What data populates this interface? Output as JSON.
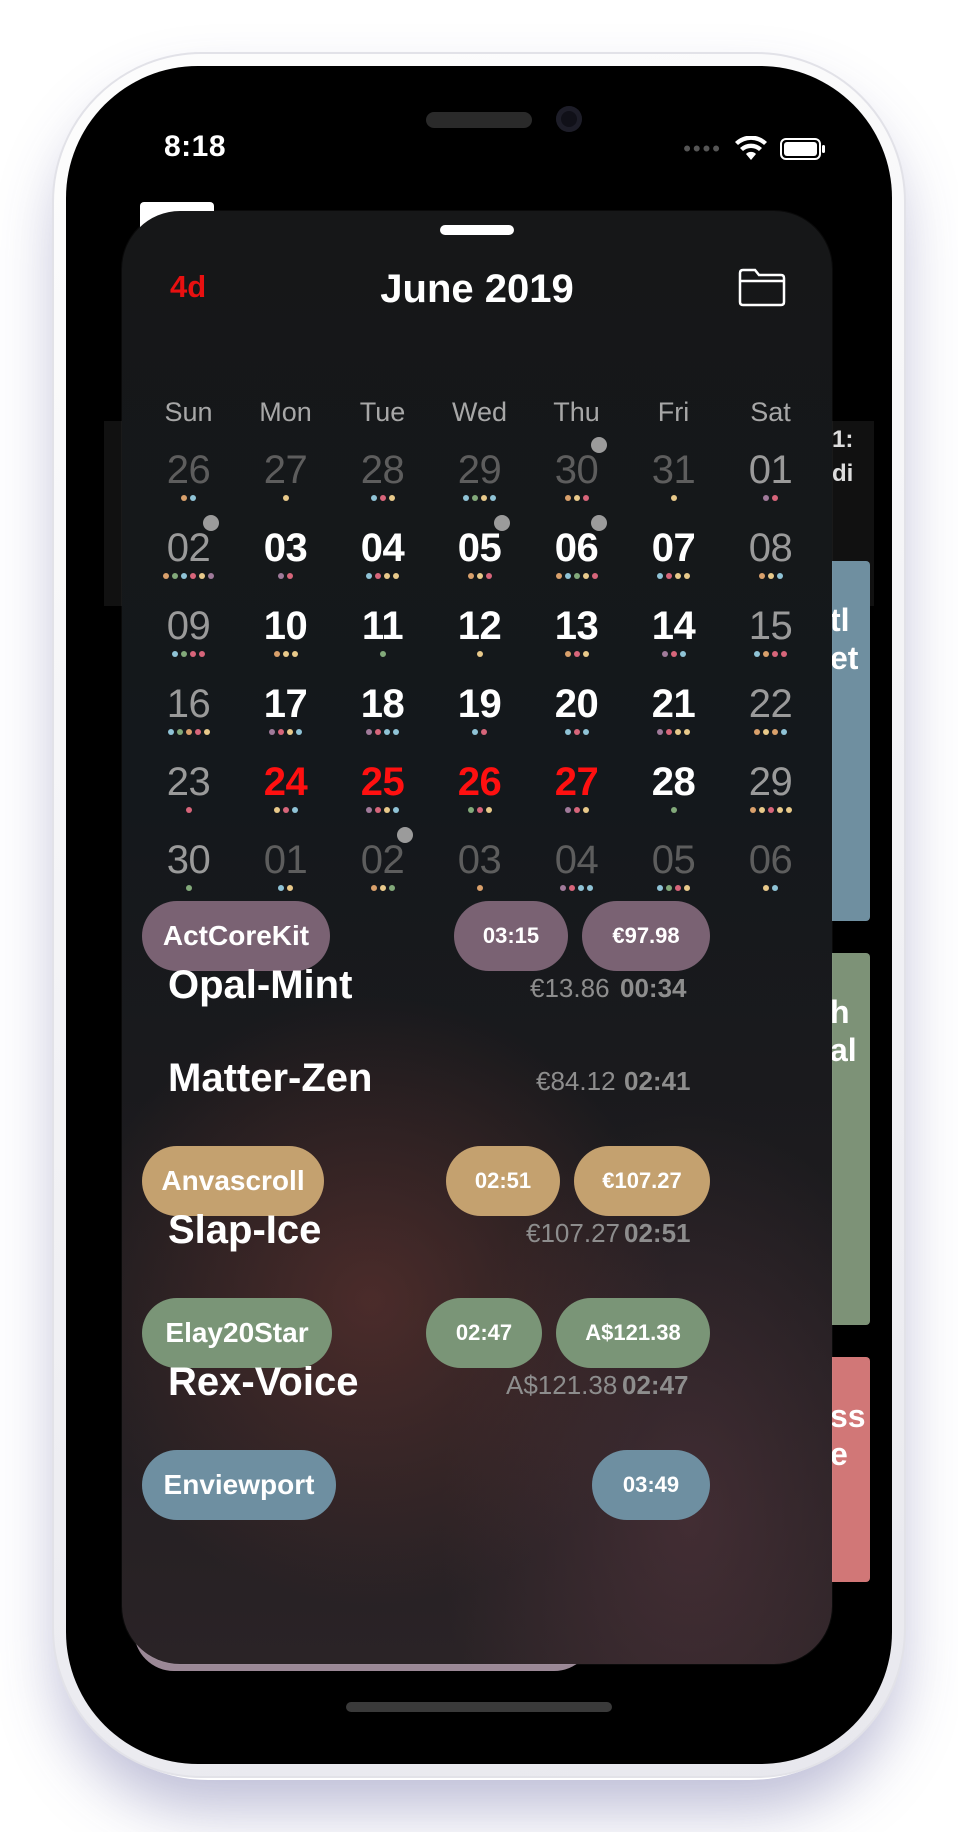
{
  "status_bar": {
    "time": "8:18"
  },
  "background_peek": {
    "text_a": "1:",
    "text_b": "di",
    "blue_card": "tl\net",
    "green_card": "h\nal",
    "pink_card": "ss\ne"
  },
  "header": {
    "left_label": "4d",
    "title": "June 2019",
    "folder_icon": "folder-icon"
  },
  "weekdays": [
    "Sun",
    "Mon",
    "Tue",
    "Wed",
    "Thu",
    "Fri",
    "Sat"
  ],
  "colors": {
    "purple": "#7a6273",
    "tan": "#c4a16f",
    "green": "#7a9577",
    "blue": "#6e8fa1",
    "red": "#ff1010"
  },
  "calendar_weeks": [
    [
      {
        "d": "26",
        "t": "other",
        "dots": [
          "#d9a06b",
          "#8fc3d6"
        ]
      },
      {
        "d": "27",
        "t": "other",
        "dots": [
          "#e8c98a"
        ]
      },
      {
        "d": "28",
        "t": "other",
        "dots": [
          "#8fc3d6",
          "#d7657a",
          "#e8c98a"
        ]
      },
      {
        "d": "29",
        "t": "other",
        "dots": [
          "#8fc3d6",
          "#82a97a",
          "#e8c98a",
          "#8fc3d6"
        ]
      },
      {
        "d": "30",
        "t": "other",
        "badge": true,
        "dots": [
          "#d9a06b",
          "#e8c98a",
          "#d7657a"
        ]
      },
      {
        "d": "31",
        "t": "other",
        "dots": [
          "#e8c98a"
        ]
      },
      {
        "d": "01",
        "t": "wk",
        "dots": [
          "#a07a9a",
          "#d7657a"
        ]
      }
    ],
    [
      {
        "d": "02",
        "t": "wk",
        "badge": true,
        "dots": [
          "#d9a06b",
          "#82a97a",
          "#8fc3d6",
          "#d7657a",
          "#e8c98a",
          "#a07a9a"
        ]
      },
      {
        "d": "03",
        "t": "cur",
        "dots": [
          "#a07a9a",
          "#d7657a"
        ]
      },
      {
        "d": "04",
        "t": "cur",
        "dots": [
          "#8fc3d6",
          "#d7657a",
          "#e8c98a",
          "#e8c98a"
        ]
      },
      {
        "d": "05",
        "t": "cur",
        "badge": true,
        "dots": [
          "#d9a06b",
          "#e8c98a",
          "#d7657a"
        ]
      },
      {
        "d": "06",
        "t": "cur",
        "badge": true,
        "dots": [
          "#d9a06b",
          "#8fc3d6",
          "#82a97a",
          "#e8c98a",
          "#d7657a"
        ]
      },
      {
        "d": "07",
        "t": "cur",
        "dots": [
          "#8fc3d6",
          "#d7657a",
          "#e8c98a",
          "#e8c98a"
        ]
      },
      {
        "d": "08",
        "t": "wk",
        "dots": [
          "#d9a06b",
          "#e8c98a",
          "#8fc3d6"
        ]
      }
    ],
    [
      {
        "d": "09",
        "t": "wk",
        "dots": [
          "#8fc3d6",
          "#82a97a",
          "#d7657a",
          "#d7657a"
        ]
      },
      {
        "d": "10",
        "t": "cur",
        "dots": [
          "#d9a06b",
          "#e8c98a",
          "#e8c98a"
        ]
      },
      {
        "d": "11",
        "t": "cur",
        "dots": [
          "#82a97a"
        ]
      },
      {
        "d": "12",
        "t": "cur",
        "dots": [
          "#e8c98a"
        ]
      },
      {
        "d": "13",
        "t": "cur",
        "dots": [
          "#d9a06b",
          "#d7657a",
          "#e8c98a"
        ]
      },
      {
        "d": "14",
        "t": "cur",
        "dots": [
          "#a07a9a",
          "#d7657a",
          "#8fc3d6"
        ]
      },
      {
        "d": "15",
        "t": "wk",
        "dots": [
          "#8fc3d6",
          "#d9a06b",
          "#d7657a",
          "#d7657a"
        ]
      }
    ],
    [
      {
        "d": "16",
        "t": "wk",
        "dots": [
          "#8fc3d6",
          "#82a97a",
          "#d9a06b",
          "#d7657a",
          "#e8c98a"
        ]
      },
      {
        "d": "17",
        "t": "cur",
        "dots": [
          "#a07a9a",
          "#d7657a",
          "#e8c98a",
          "#8fc3d6"
        ]
      },
      {
        "d": "18",
        "t": "cur",
        "dots": [
          "#a07a9a",
          "#d7657a",
          "#8fc3d6",
          "#8fc3d6"
        ]
      },
      {
        "d": "19",
        "t": "cur",
        "dots": [
          "#8fc3d6",
          "#d7657a"
        ]
      },
      {
        "d": "20",
        "t": "cur",
        "dots": [
          "#8fc3d6",
          "#d7657a",
          "#8fc3d6"
        ]
      },
      {
        "d": "21",
        "t": "cur",
        "dots": [
          "#a07a9a",
          "#d7657a",
          "#e8c98a",
          "#e8c98a"
        ]
      },
      {
        "d": "22",
        "t": "wk",
        "dots": [
          "#d9a06b",
          "#e8c98a",
          "#d9a06b",
          "#8fc3d6"
        ]
      }
    ],
    [
      {
        "d": "23",
        "t": "wk",
        "dots": [
          "#d7657a"
        ]
      },
      {
        "d": "24",
        "t": "red",
        "dots": [
          "#e8c98a",
          "#d7657a",
          "#8fc3d6"
        ]
      },
      {
        "d": "25",
        "t": "red",
        "dots": [
          "#a07a9a",
          "#d7657a",
          "#e8c98a",
          "#8fc3d6"
        ]
      },
      {
        "d": "26",
        "t": "red",
        "dots": [
          "#82a97a",
          "#d7657a",
          "#e8c98a"
        ]
      },
      {
        "d": "27",
        "t": "red",
        "dots": [
          "#a07a9a",
          "#d7657a",
          "#e8c98a"
        ]
      },
      {
        "d": "28",
        "t": "cur",
        "dots": [
          "#82a97a"
        ]
      },
      {
        "d": "29",
        "t": "wk",
        "dots": [
          "#d9a06b",
          "#e8c98a",
          "#d7657a",
          "#e8c98a",
          "#e8c98a"
        ]
      }
    ],
    [
      {
        "d": "30",
        "t": "wk",
        "dots": [
          "#82a97a"
        ]
      },
      {
        "d": "01",
        "t": "other",
        "dots": [
          "#8fc3d6",
          "#e8c98a"
        ]
      },
      {
        "d": "02",
        "t": "other",
        "badge": true,
        "dots": [
          "#d9a06b",
          "#e8c98a",
          "#82a97a"
        ]
      },
      {
        "d": "03",
        "t": "other",
        "dots": [
          "#d9a06b"
        ]
      },
      {
        "d": "04",
        "t": "other",
        "dots": [
          "#a07a9a",
          "#d7657a",
          "#8fc3d6",
          "#8fc3d6"
        ]
      },
      {
        "d": "05",
        "t": "other",
        "dots": [
          "#8fc3d6",
          "#82a97a",
          "#d7657a",
          "#e8c98a"
        ]
      },
      {
        "d": "06",
        "t": "other",
        "dots": [
          "#e8c98a",
          "#8fc3d6"
        ]
      }
    ]
  ],
  "events": {
    "e1": {
      "name": "ActCoreKit",
      "time": "03:15",
      "price": "€97.98"
    },
    "e2": {
      "name": "Opal-Mint",
      "price": "€13.86",
      "time": "00:34"
    },
    "e3": {
      "name": "Matter-Zen",
      "price": "€84.12",
      "time": "02:41"
    },
    "e4": {
      "name": "Anvascroll",
      "time": "02:51",
      "price": "€107.27"
    },
    "e5": {
      "name": "Slap-Ice",
      "price": "€107.27",
      "time": "02:51"
    },
    "e6": {
      "name": "Elay20Star",
      "time": "02:47",
      "price": "A$121.38"
    },
    "e7": {
      "name": "Rex-Voice",
      "price": "A$121.38",
      "time": "02:47"
    },
    "e8": {
      "name": "Enviewport",
      "time": "03:49"
    }
  }
}
